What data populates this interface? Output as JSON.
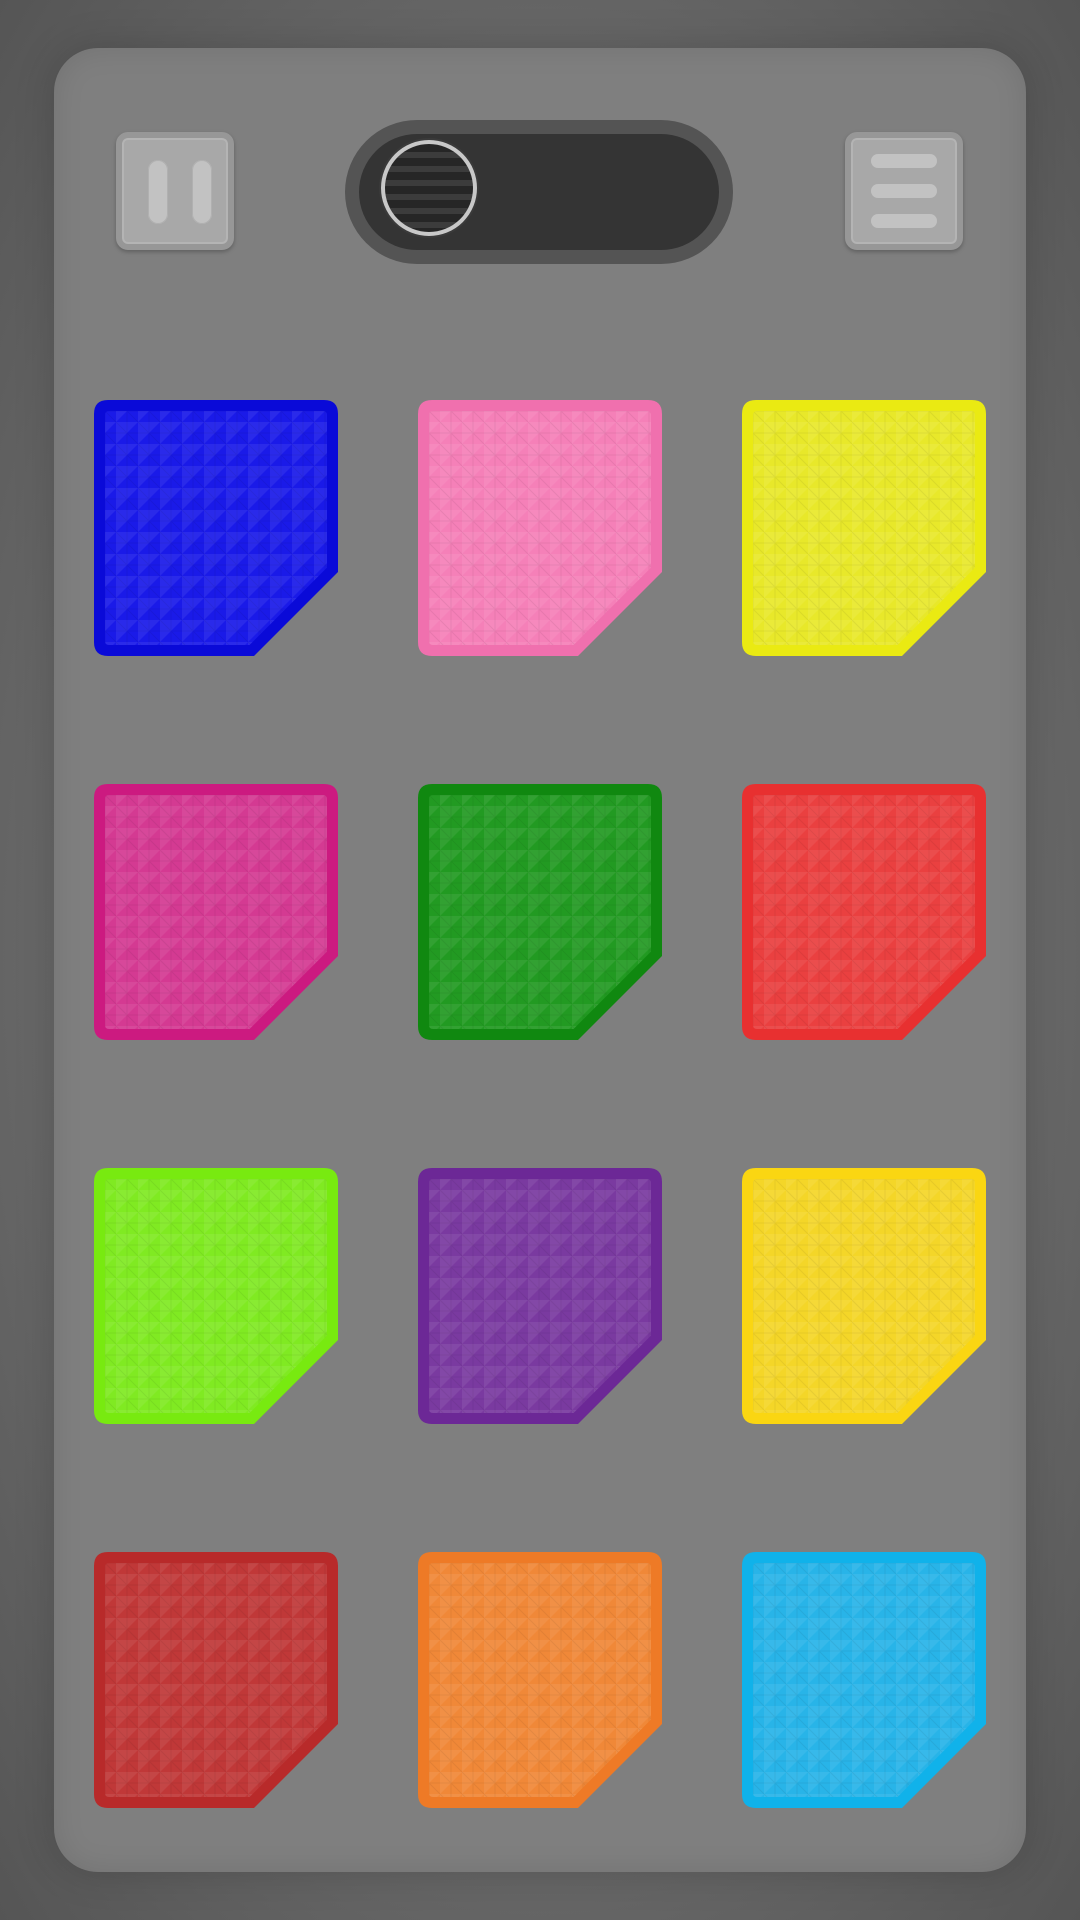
{
  "controls": {
    "pause_icon": "pause-icon",
    "toggle_icon": "toggle-switch",
    "menu_icon": "hamburger-menu-icon"
  },
  "tiles": [
    {
      "id": "tile-blue",
      "color": "#1a1ae8",
      "border": "#0a0ad8"
    },
    {
      "id": "tile-pink",
      "color": "#f580b8",
      "border": "#f070ae"
    },
    {
      "id": "tile-yellow",
      "color": "#e8e82a",
      "border": "#eaea12"
    },
    {
      "id": "tile-magenta",
      "color": "#d43a92",
      "border": "#cc1a80"
    },
    {
      "id": "tile-green",
      "color": "#229a22",
      "border": "#108810"
    },
    {
      "id": "tile-red",
      "color": "#ea4040",
      "border": "#e83030"
    },
    {
      "id": "tile-lime",
      "color": "#80ea22",
      "border": "#78ea10"
    },
    {
      "id": "tile-purple",
      "color": "#7a3aa0",
      "border": "#6c2896"
    },
    {
      "id": "tile-gold",
      "color": "#f4d628",
      "border": "#fad612"
    },
    {
      "id": "tile-darkred",
      "color": "#c03838",
      "border": "#b82a2a"
    },
    {
      "id": "tile-orange",
      "color": "#f08838",
      "border": "#ee7a26"
    },
    {
      "id": "tile-skyblue",
      "color": "#28b4e8",
      "border": "#10b2ea"
    }
  ]
}
